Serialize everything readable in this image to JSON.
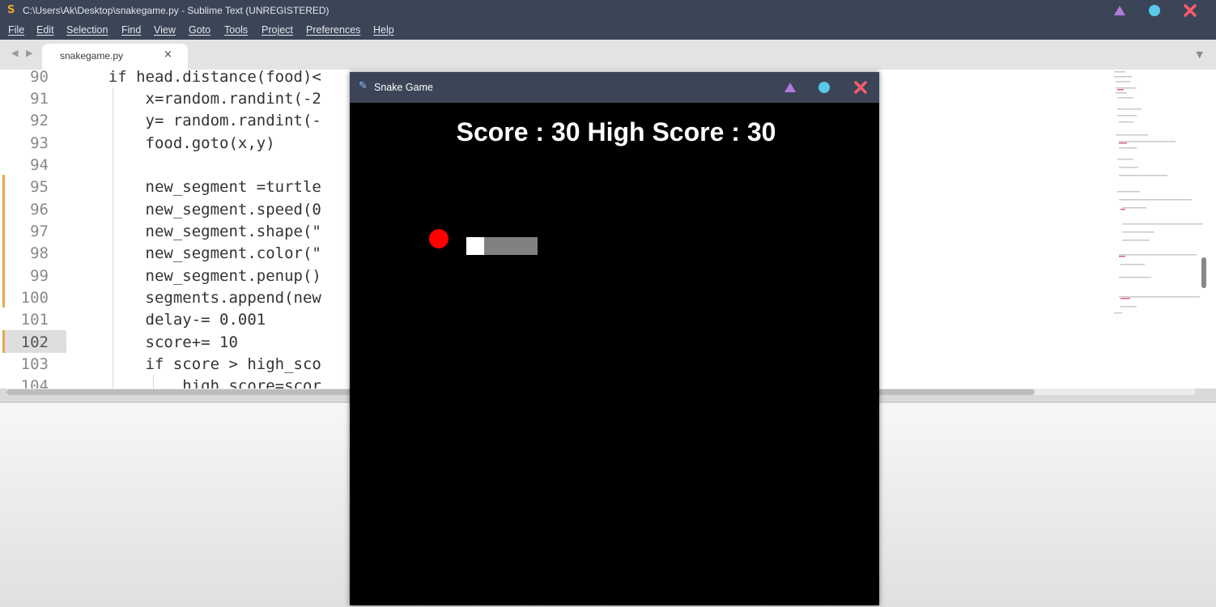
{
  "window": {
    "title": "C:\\Users\\Ak\\Desktop\\snakegame.py - Sublime Text (UNREGISTERED)"
  },
  "menu": [
    "File",
    "Edit",
    "Selection",
    "Find",
    "View",
    "Goto",
    "Tools",
    "Project",
    "Preferences",
    "Help"
  ],
  "tabs": {
    "nav": "◀ ▶",
    "active": {
      "label": "snakegame.py",
      "close": "×"
    },
    "dropdown": "▼"
  },
  "editor": {
    "lines": [
      {
        "no": "90",
        "text": "    if head.distance(food)<"
      },
      {
        "no": "91",
        "text": "        x=random.randint(-2"
      },
      {
        "no": "92",
        "text": "        y= random.randint(-"
      },
      {
        "no": "93",
        "text": "        food.goto(x,y)"
      },
      {
        "no": "94",
        "text": ""
      },
      {
        "no": "95",
        "text": "        new_segment =turtle"
      },
      {
        "no": "96",
        "text": "        new_segment.speed(0"
      },
      {
        "no": "97",
        "text": "        new_segment.shape(\""
      },
      {
        "no": "98",
        "text": "        new_segment.color(\""
      },
      {
        "no": "99",
        "text": "        new_segment.penup()"
      },
      {
        "no": "100",
        "text": "        segments.append(new"
      },
      {
        "no": "101",
        "text": "        delay-= 0.001"
      },
      {
        "no": "102",
        "text": "        score+= 10"
      },
      {
        "no": "103",
        "text": "        if score > high_sco"
      },
      {
        "no": "104",
        "text": "            high_score=scor"
      }
    ],
    "active_line": "102"
  },
  "snake_game": {
    "title": "Snake Game",
    "score_text": "Score : 30 High Score : 30",
    "colors": {
      "food": "#ff0000",
      "head": "#ffffff",
      "body": "#808080",
      "background": "#000000"
    }
  },
  "colors": {
    "titlebar": "#3b4557",
    "accent_purple": "#b07ad8",
    "accent_cyan": "#5ac8e8",
    "accent_red": "#ff5a6e"
  }
}
